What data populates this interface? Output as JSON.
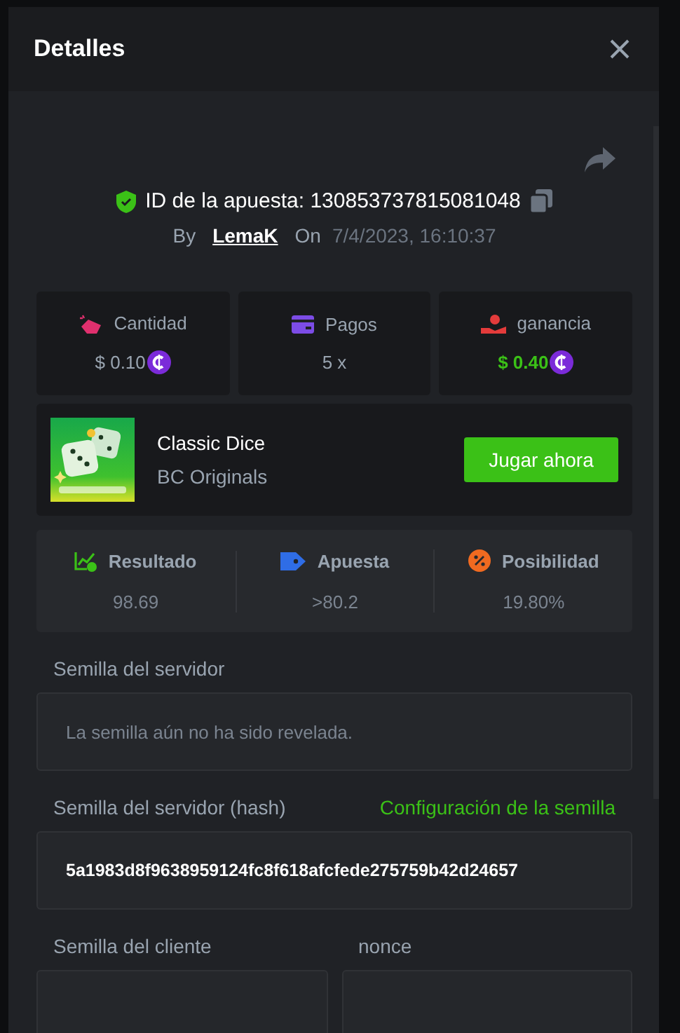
{
  "dialog": {
    "title": "Detalles"
  },
  "bet": {
    "id_label": "ID de la apuesta: 130853737815081048",
    "by_label": "By",
    "user": "LemaK",
    "on_label": "On",
    "date": "7/4/2023, 16:10:37"
  },
  "stats": [
    {
      "kind": "amount",
      "label": "Cantidad",
      "value": "$ 0.10",
      "coin": true,
      "win": false
    },
    {
      "kind": "payout",
      "label": "Pagos",
      "value": "5 x",
      "coin": false,
      "win": false
    },
    {
      "kind": "profit",
      "label": "ganancia",
      "value": "$ 0.40",
      "coin": true,
      "win": true
    }
  ],
  "game": {
    "title": "Classic Dice",
    "provider": "BC Originals",
    "play_button": "Jugar ahora"
  },
  "results": [
    {
      "kind": "result",
      "label": "Resultado",
      "value": "98.69"
    },
    {
      "kind": "bet",
      "label": "Apuesta",
      "value": ">80.2"
    },
    {
      "kind": "chance",
      "label": "Posibilidad",
      "value": "19.80%"
    }
  ],
  "server_seed": {
    "label": "Semilla del servidor",
    "value": "La semilla aún no ha sido revelada."
  },
  "server_hash": {
    "label": "Semilla del servidor (hash)",
    "link": "Configuración de la semilla",
    "value": "5a1983d8f9638959124fc8f618afcfede275759b42d24657"
  },
  "client_seed": {
    "label": "Semilla del cliente"
  },
  "nonce": {
    "label": "nonce"
  }
}
